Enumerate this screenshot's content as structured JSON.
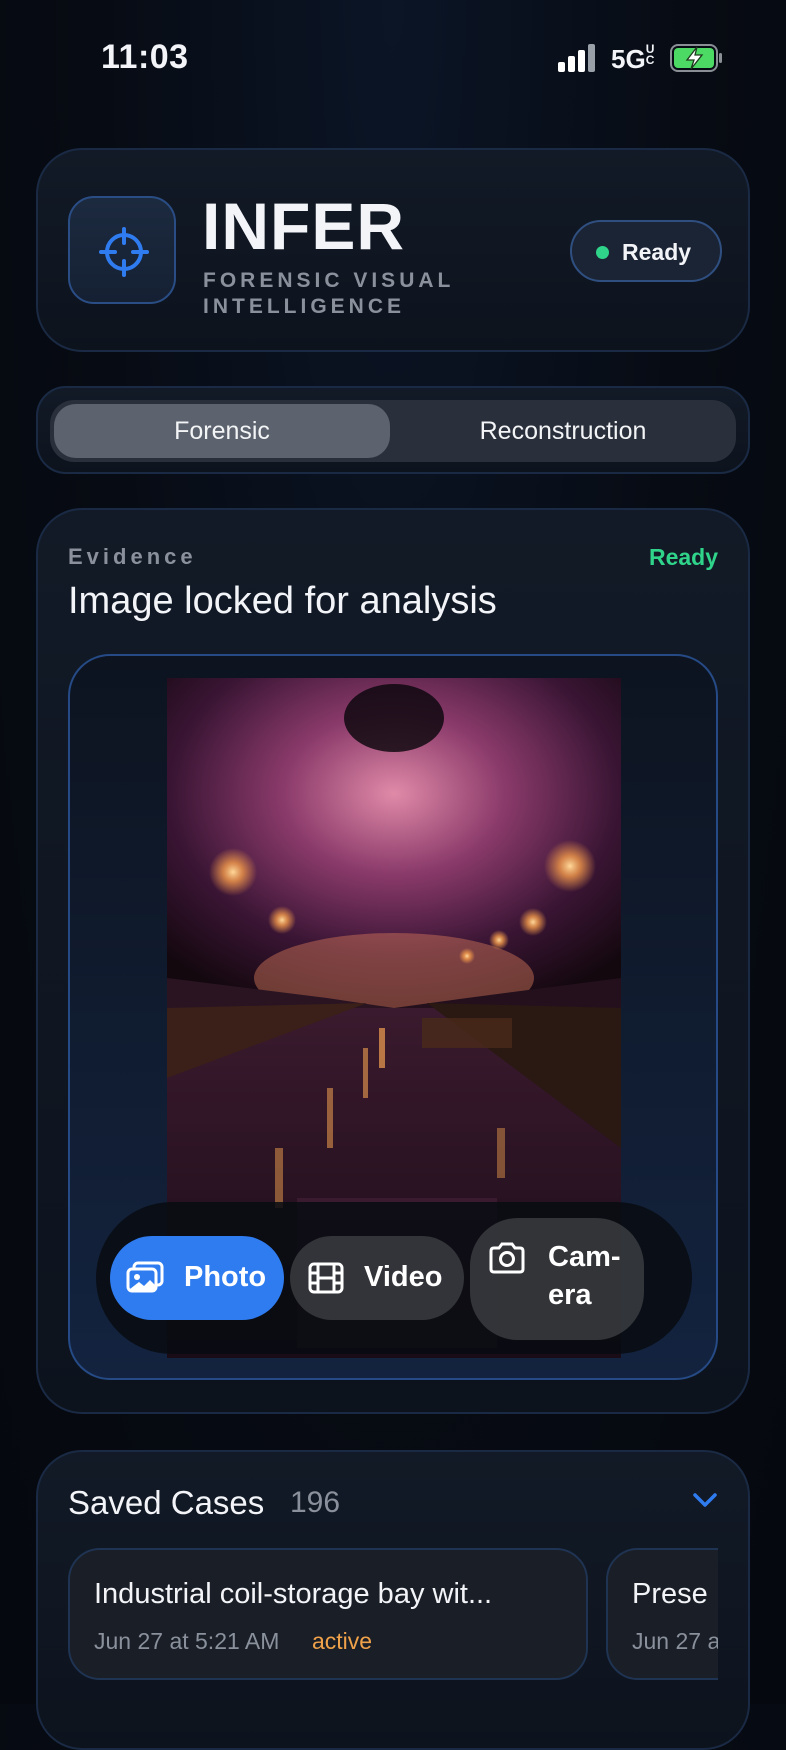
{
  "status_bar": {
    "time": "11:03",
    "network": "5G",
    "network_sup": "UC"
  },
  "header": {
    "title": "INFER",
    "subtitle": "FORENSIC VISUAL INTELLIGENCE",
    "status": "Ready"
  },
  "mode_tabs": [
    {
      "label": "Forensic",
      "selected": true
    },
    {
      "label": "Reconstruction",
      "selected": false
    }
  ],
  "evidence": {
    "section_label": "Evidence",
    "status": "Ready",
    "title": "Image locked for analysis",
    "image_description": "Night canal lined with glowing cherry-blossom trees and lanterns",
    "sources": [
      {
        "label": "Photo",
        "icon": "photo-icon",
        "selected": true
      },
      {
        "label": "Video",
        "icon": "film-icon",
        "selected": false
      },
      {
        "label": "Cam-\nera",
        "icon": "camera-icon",
        "selected": false
      }
    ]
  },
  "saved_cases": {
    "title": "Saved Cases",
    "count": "196",
    "items": [
      {
        "title": "Industrial coil-storage bay wit...",
        "date": "Jun 27 at 5:21 AM",
        "state": "active"
      },
      {
        "title": "Prese",
        "date": "Jun 27 a",
        "state": ""
      }
    ]
  },
  "colors": {
    "accent": "#2f7cf0",
    "ready_green": "#2fd48a",
    "active_orange": "#f0a24a"
  }
}
